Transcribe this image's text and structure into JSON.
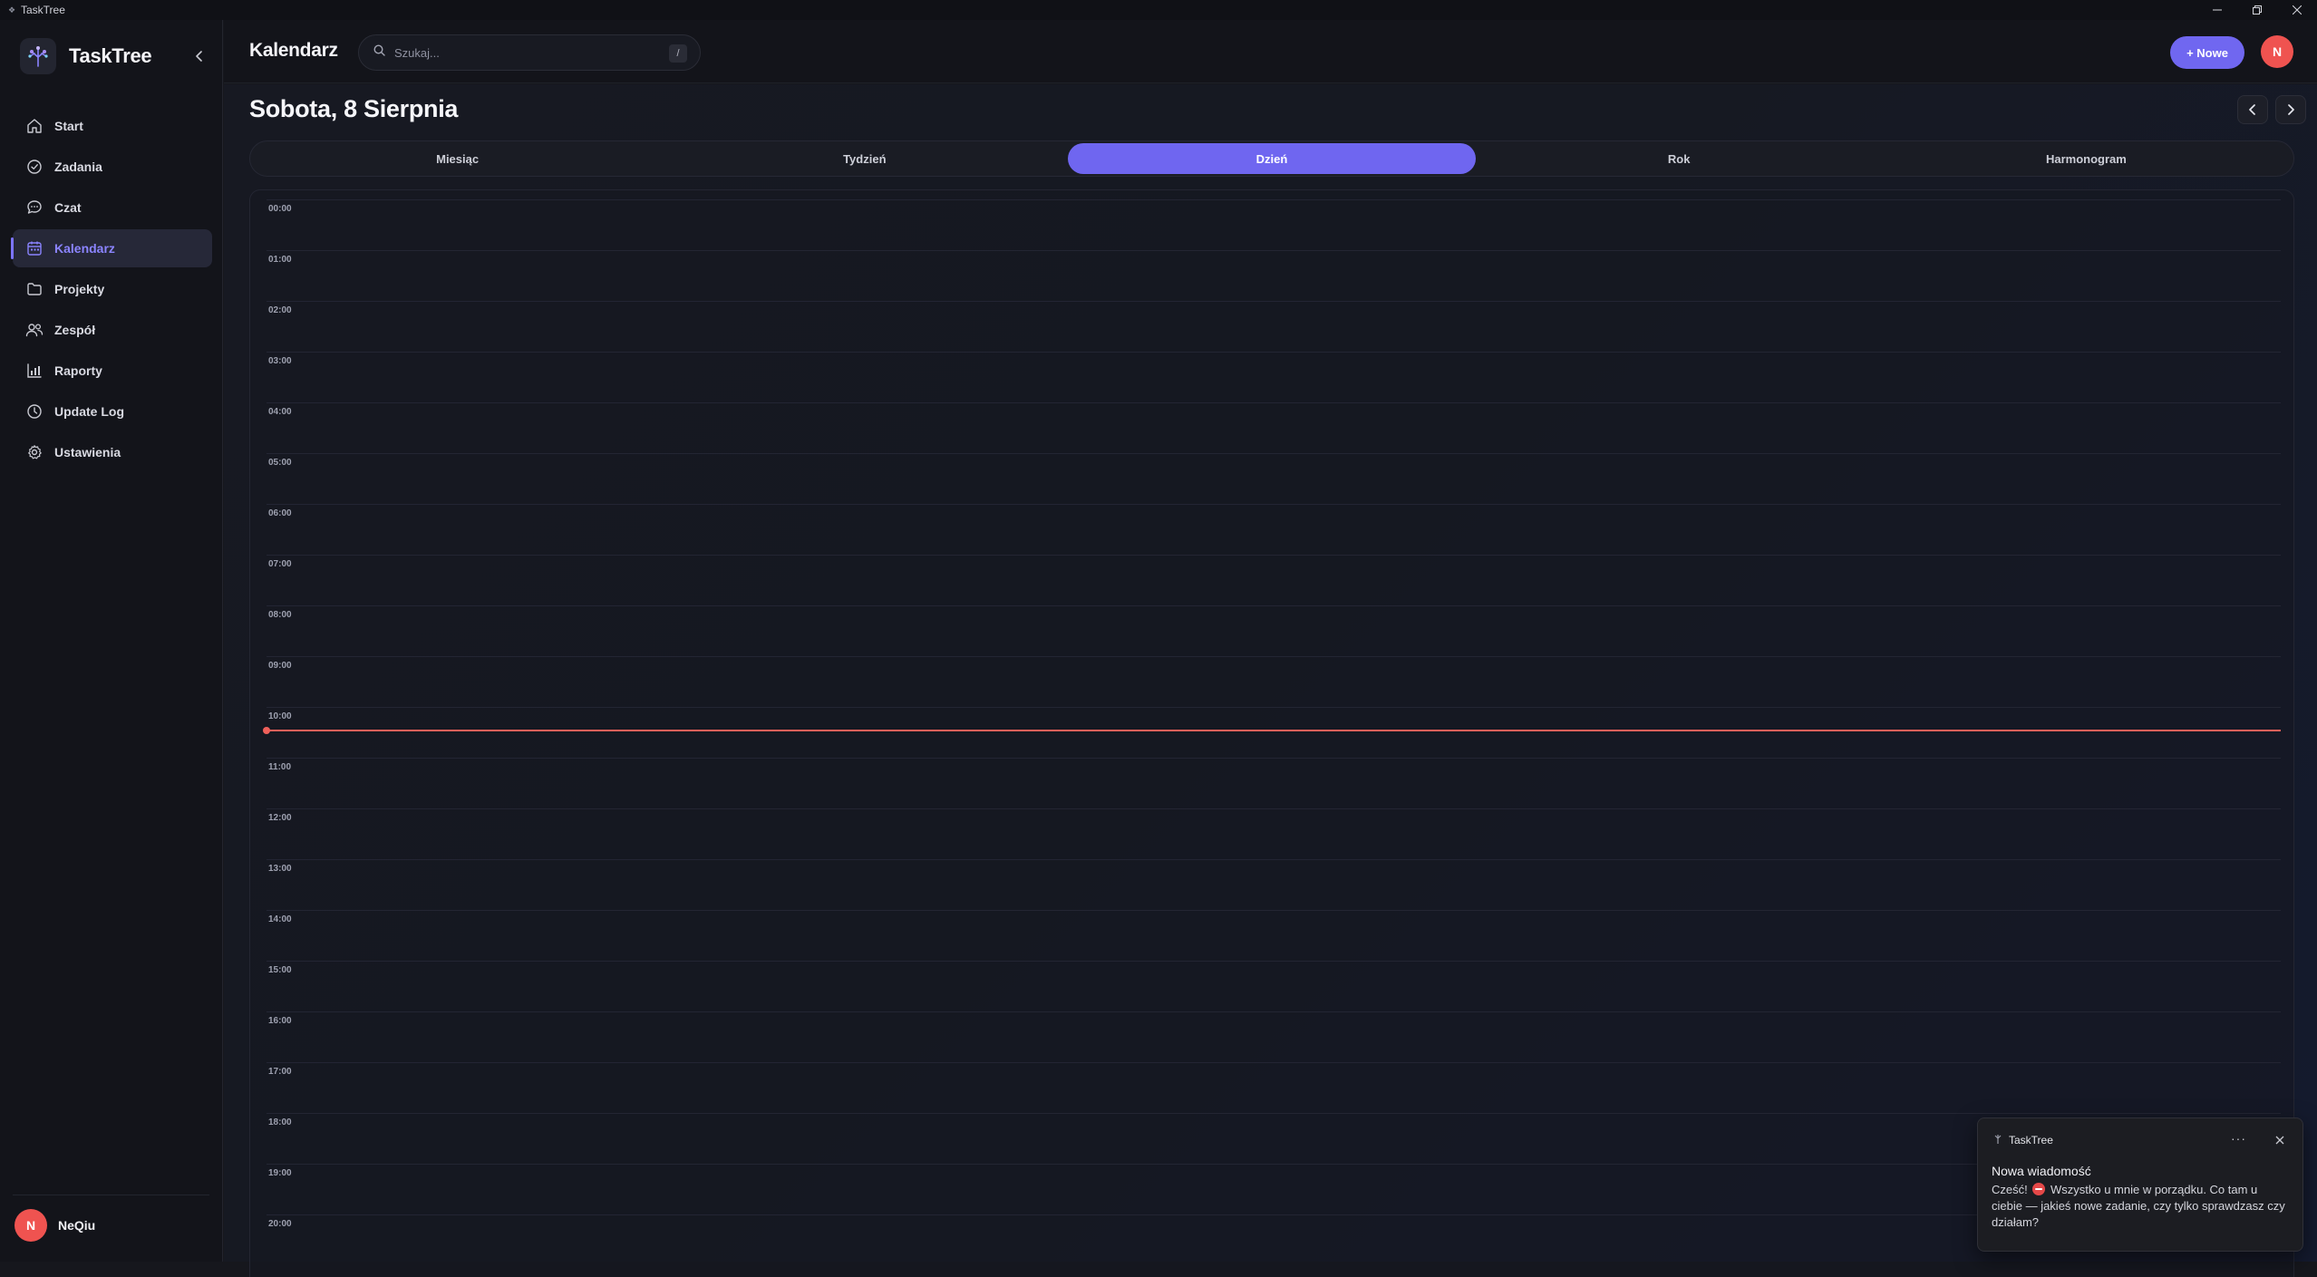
{
  "window": {
    "title": "TaskTree"
  },
  "brand": {
    "name": "TaskTree"
  },
  "sidebar": {
    "items": [
      {
        "label": "Start",
        "icon": "home-icon"
      },
      {
        "label": "Zadania",
        "icon": "check-circle-icon"
      },
      {
        "label": "Czat",
        "icon": "chat-bubble-icon"
      },
      {
        "label": "Kalendarz",
        "icon": "calendar-icon",
        "active": true
      },
      {
        "label": "Projekty",
        "icon": "folder-icon"
      },
      {
        "label": "Zespół",
        "icon": "users-icon"
      },
      {
        "label": "Raporty",
        "icon": "bar-chart-icon"
      },
      {
        "label": "Update Log",
        "icon": "clock-icon"
      },
      {
        "label": "Ustawienia",
        "icon": "gear-icon"
      }
    ],
    "user": {
      "initial": "N",
      "name": "NeQiu"
    }
  },
  "header": {
    "title": "Kalendarz",
    "search_placeholder": "Szukaj...",
    "search_shortcut": "/",
    "new_button": "+ Nowe",
    "avatar_initial": "N"
  },
  "calendar": {
    "date_title": "Sobota, 8 Sierpnia",
    "tabs": [
      "Miesiąc",
      "Tydzień",
      "Dzień",
      "Rok",
      "Harmonogram"
    ],
    "active_tab": "Dzień",
    "hours": [
      "00:00",
      "01:00",
      "02:00",
      "03:00",
      "04:00",
      "05:00",
      "06:00",
      "07:00",
      "08:00",
      "09:00",
      "10:00",
      "11:00",
      "12:00",
      "13:00",
      "14:00",
      "15:00",
      "16:00",
      "17:00",
      "18:00",
      "19:00",
      "20:00"
    ],
    "current_time_hours": 10.45
  },
  "toast": {
    "app": "TaskTree",
    "more": "···",
    "title": "Nowa wiadomość",
    "body_before": "Cześć!",
    "body_after": "Wszystko u mnie w porządku. Co tam u ciebie — jakieś nowe zadanie, czy tylko sprawdzasz czy działam?"
  },
  "colors": {
    "accent": "#6f66f0",
    "now_line": "#f0605a",
    "avatar": "#ef5350"
  }
}
